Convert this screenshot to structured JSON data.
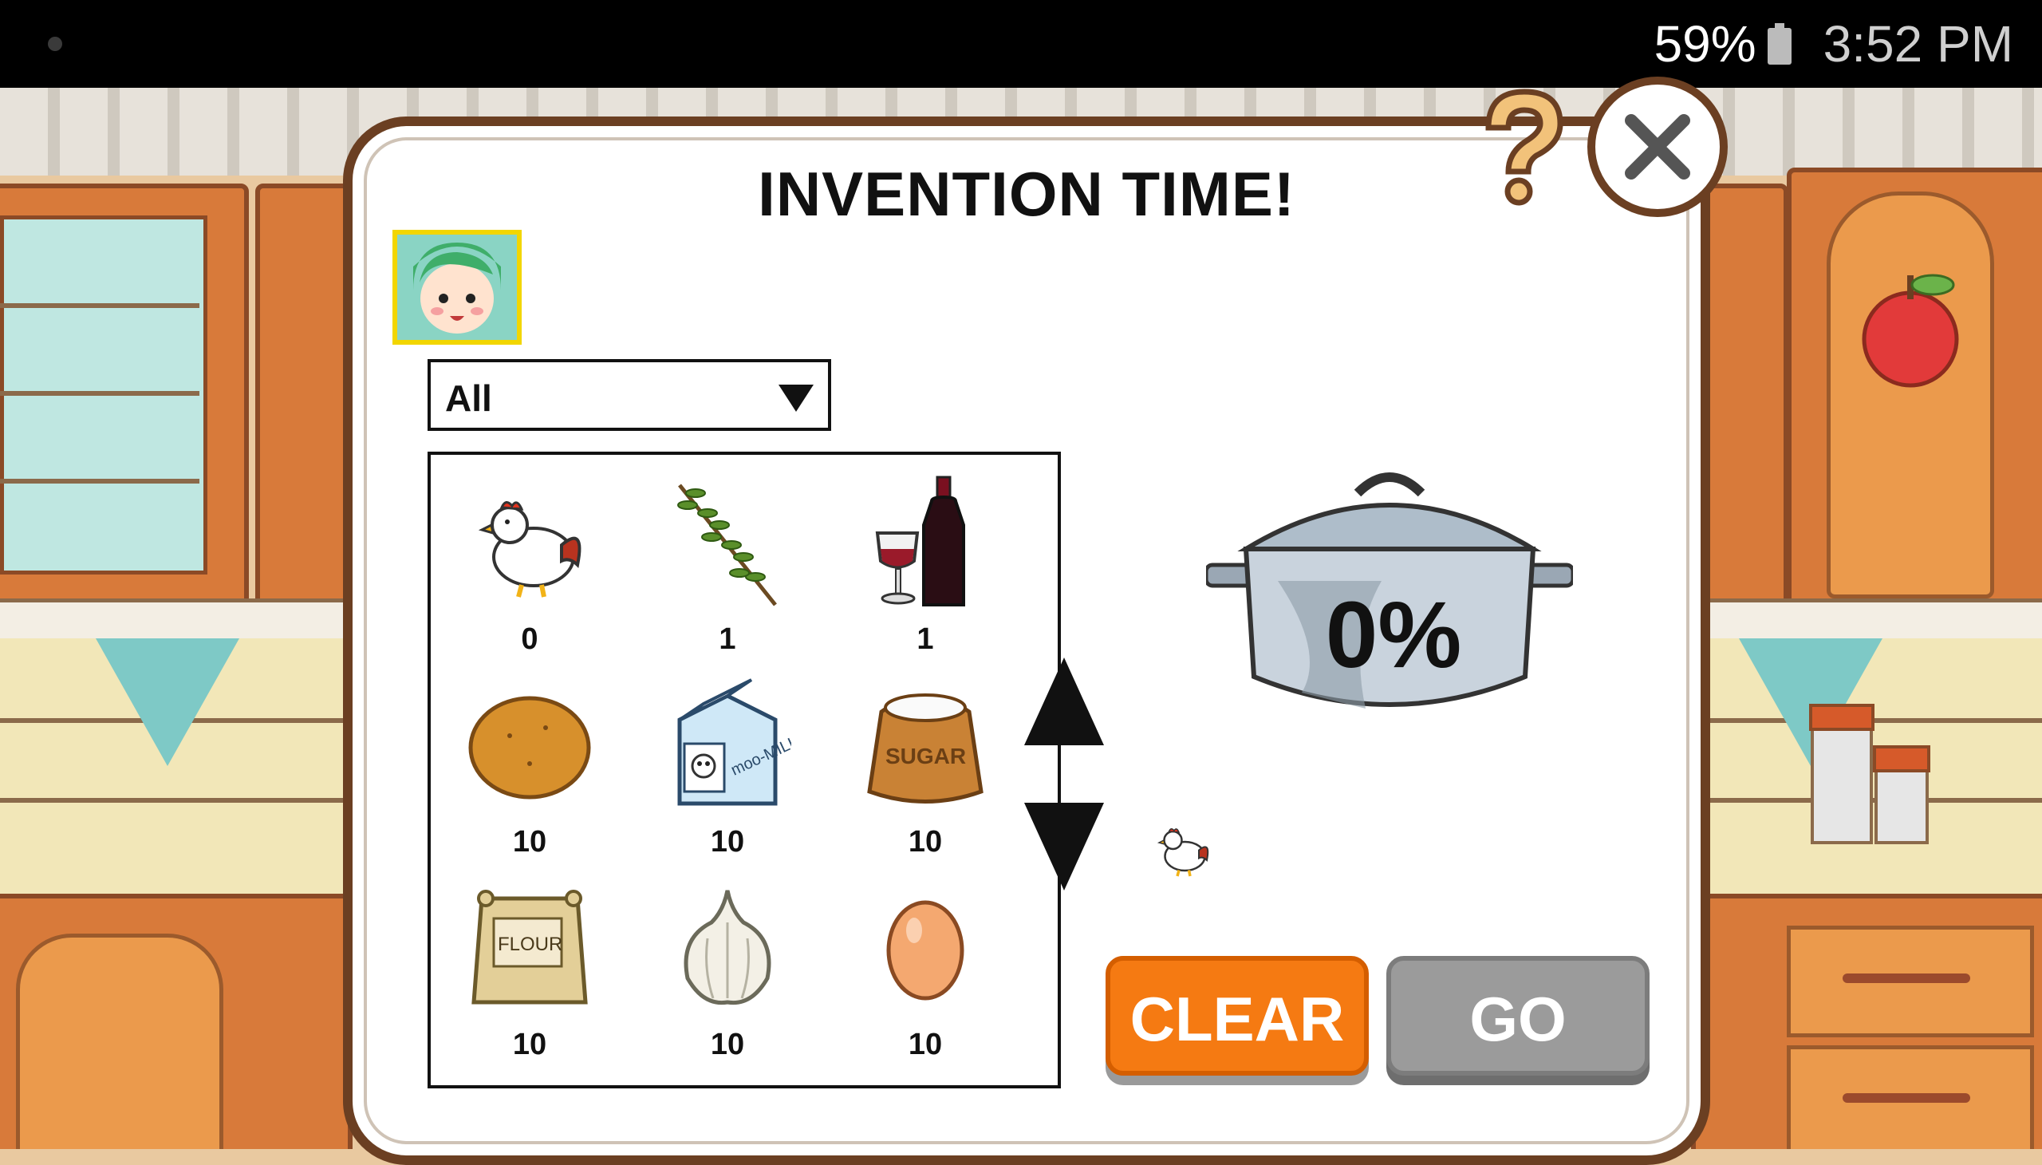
{
  "status_bar": {
    "battery": "59%",
    "time": "3:52 PM"
  },
  "dialog": {
    "title": "INVENTION TIME!",
    "filter": {
      "selected": "All"
    },
    "ingredients": [
      {
        "name": "chicken",
        "quantity": "0"
      },
      {
        "name": "herb",
        "quantity": "1"
      },
      {
        "name": "wine",
        "quantity": "1"
      },
      {
        "name": "potato",
        "quantity": "10"
      },
      {
        "name": "milk",
        "quantity": "10"
      },
      {
        "name": "sugar",
        "quantity": "10"
      },
      {
        "name": "flour",
        "quantity": "10"
      },
      {
        "name": "garlic",
        "quantity": "10"
      },
      {
        "name": "egg",
        "quantity": "10"
      }
    ],
    "pot": {
      "progress_label": "0%"
    },
    "buttons": {
      "clear": "CLEAR",
      "go": "GO"
    },
    "package_labels": {
      "milk": "moo-MILK",
      "sugar": "SUGAR",
      "flour": "FLOUR"
    }
  }
}
